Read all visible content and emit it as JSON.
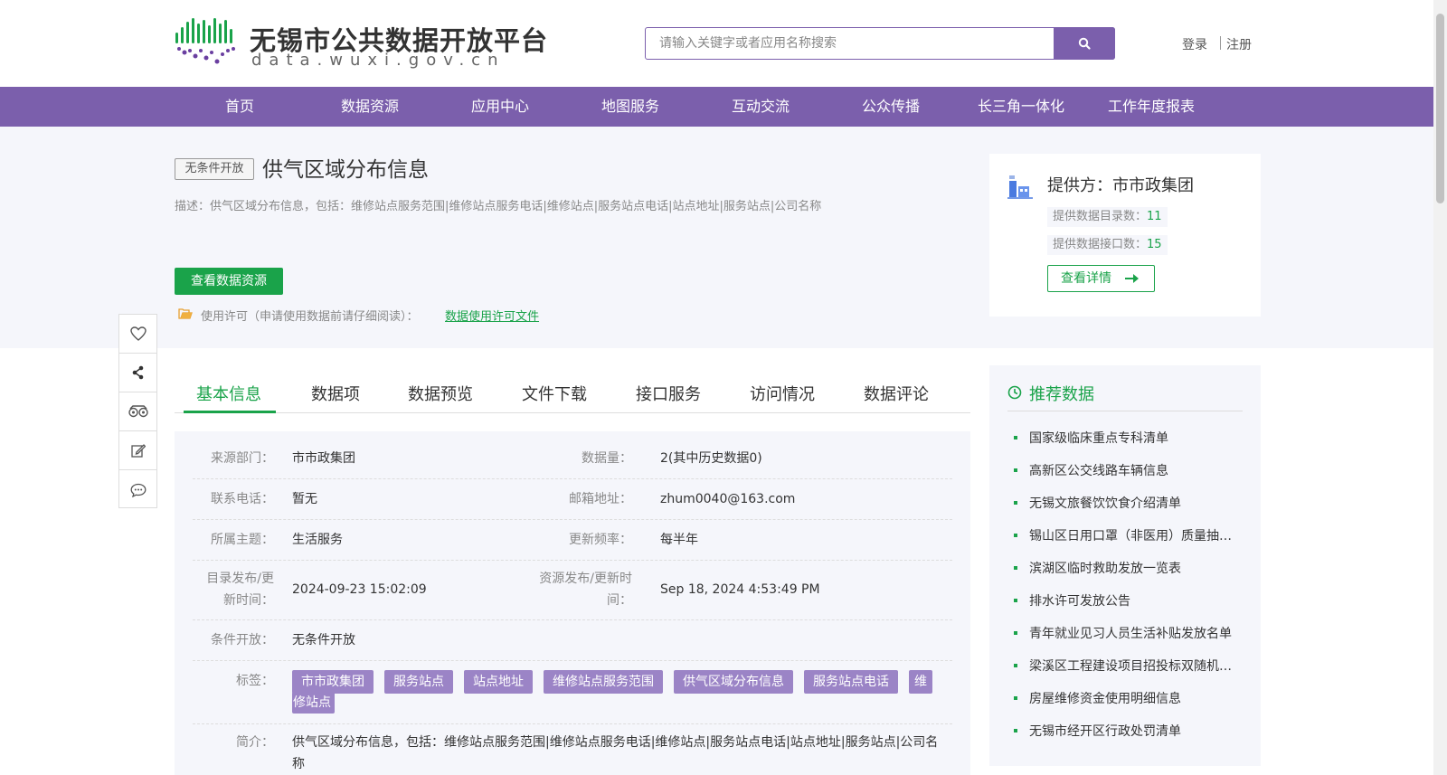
{
  "header": {
    "logo_title": "无锡市公共数据开放平台",
    "logo_sub": "data.wuxi.gov.cn",
    "search_placeholder": "请输入关键字或者应用名称搜索",
    "login": "登录",
    "register": "注册"
  },
  "nav": {
    "items": [
      "首页",
      "数据资源",
      "应用中心",
      "地图服务",
      "互动交流",
      "公众传播",
      "长三角一体化",
      "工作年度报表"
    ]
  },
  "dataset": {
    "badge": "无条件开放",
    "title": "供气区域分布信息",
    "description": "描述：供气区域分布信息，包括：维修站点服务范围|维修站点服务电话|维修站点|服务站点电话|站点地址|服务站点|公司名称",
    "view_button": "查看数据资源",
    "license_text": "使用许可（申请使用数据前请仔细阅读）：",
    "license_link": "数据使用许可文件"
  },
  "provider": {
    "name": "提供方：市市政集团",
    "catalog_label": "提供数据目录数：",
    "catalog_count": "11",
    "api_label": "提供数据接口数：",
    "api_count": "15",
    "detail_button": "查看详情"
  },
  "tabs": [
    "基本信息",
    "数据项",
    "数据预览",
    "文件下载",
    "接口服务",
    "访问情况",
    "数据评论"
  ],
  "info": {
    "source_label": "来源部门：",
    "source_value": "市市政集团",
    "volume_label": "数据量：",
    "volume_value": "2(其中历史数据0)",
    "phone_label": "联系电话：",
    "phone_value": "暂无",
    "email_label": "邮箱地址：",
    "email_value": "zhum0040@163.com",
    "topic_label": "所属主题：",
    "topic_value": "生活服务",
    "freq_label": "更新频率：",
    "freq_value": "每半年",
    "catalog_time_label1": "目录发布/更",
    "catalog_time_label2": "新时间：",
    "catalog_time_value": "2024-09-23 15:02:09",
    "resource_time_label1": "资源发布/更新时",
    "resource_time_label2": "间：",
    "resource_time_value": "Sep 18, 2024 4:53:49 PM",
    "condition_label": "条件开放：",
    "condition_value": "无条件开放",
    "tags_label": "标签：",
    "tags": [
      "市市政集团",
      "服务站点",
      "站点地址",
      "维修站点服务范围",
      "供气区域分布信息",
      "服务站点电话",
      "维",
      "修站点"
    ],
    "intro_label": "简介：",
    "intro_line1": "供气区域分布信息，包括：维修站点服务范围|维修站点服务电话|维修站点|服务站点电话|站点地址|服务站点|公司名",
    "intro_line2": "称"
  },
  "recommend": {
    "title": "推荐数据",
    "items": [
      "国家级临床重点专科清单",
      "高新区公交线路车辆信息",
      "无锡文旅餐饮饮食介绍清单",
      "锡山区日用口罩（非医用）质量抽检信息",
      "滨湖区临时救助发放一览表",
      "排水许可发放公告",
      "青年就业见习人员生活补贴发放名单",
      "梁溪区工程建设项目招投标双随机抽查",
      "房屋维修资金使用明细信息",
      "无锡市经开区行政处罚清单"
    ]
  },
  "colors": {
    "accent_purple": "#7b5fac",
    "accent_green": "#1aa34a",
    "tag_purple": "#9b84c6"
  }
}
